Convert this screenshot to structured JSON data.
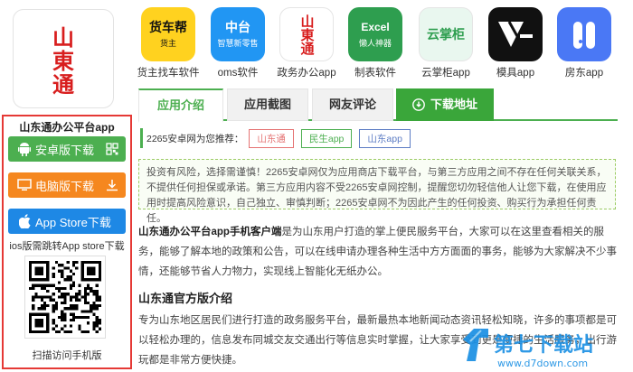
{
  "app": {
    "logo_text": "山東通",
    "panel_title": "山东通办公平台app"
  },
  "downloads": {
    "android_label": "安卓版下载",
    "pc_label": "电脑版下载",
    "ios_label": "App Store下载",
    "ios_note": "ios版需跳转App store下载",
    "qr_caption": "扫描访问手机版"
  },
  "related_apps": [
    {
      "name": "货主找车软件",
      "icon": "truck-app-icon",
      "icon_text": "货车帮",
      "sub": "货主",
      "bg": "#ffd21f",
      "fg": "#111"
    },
    {
      "name": "oms软件",
      "icon": "oms-app-icon",
      "icon_text": "中台",
      "sub": "智慧新零售",
      "bg": "#2196f3",
      "fg": "#fff"
    },
    {
      "name": "政务办公app",
      "icon": "gov-office-app-icon",
      "icon_text": "山東通",
      "sub": "",
      "bg": "#ffffff",
      "fg": "#d81e1e"
    },
    {
      "name": "制表软件",
      "icon": "excel-app-icon",
      "icon_text": "Excel",
      "sub": "懒人神器",
      "bg": "#2e9e4f",
      "fg": "#fff"
    },
    {
      "name": "云掌柜app",
      "icon": "cloud-manager-app-icon",
      "icon_text": "云掌柜",
      "sub": "",
      "bg": "#e9f7ef",
      "fg": "#2e9e4f"
    },
    {
      "name": "模具app",
      "icon": "mold-app-icon",
      "icon_text": "M",
      "sub": "",
      "bg": "#111111",
      "fg": "#fff"
    },
    {
      "name": "房东app",
      "icon": "landlord-app-icon",
      "icon_text": "",
      "sub": "",
      "bg": "#4a78f5",
      "fg": "#fff"
    }
  ],
  "tabs": {
    "intro": "应用介绍",
    "screenshots": "应用截图",
    "comments": "网友评论",
    "download": "下载地址"
  },
  "recommend": {
    "label": "2265安卓网为您推荐：",
    "tags": [
      {
        "text": "山东通",
        "color": "#e57373"
      },
      {
        "text": "民生app",
        "color": "#4caf50"
      },
      {
        "text": "山东app",
        "color": "#5c7cc4"
      }
    ]
  },
  "disclaimer": "投资有风险，选择需谨慎！2265安卓网仅为应用商店下载平台，与第三方应用之间不存在任何关联关系，不提供任何担保或承诺。第三方应用内容不受2265安卓网控制，提醒您切勿轻信他人让您下载，在使用应用时提高风险意识，自己独立、审慎判断；2265安卓网不为因此产生的任何投资、购买行为承担任何责任。",
  "intro": {
    "lead_bold": "山东通办公平台app手机客户端",
    "lead_rest": "是为山东用户打造的掌上便民服务平台，大家可以在这里查看相关的服务，能够了解本地的政策和公告，可以在线申请办理各种生活中方方面面的事务，能够为大家解决不少事情，还能够节省人力物力，实现线上智能化无纸办公。",
    "section_title": "山东通官方版介绍",
    "section_text": "专为山东地区居民们进行打造的政务服务平台，最新最热本地新闻动态资讯轻松知晓，许多的事项都是可以轻松办理的，信息发布同城交友交通出行等信息实时掌握，让大家享受到更是便捷的生活服务，出行游玩都是非常方便快捷。"
  },
  "watermark": {
    "brand": "第七下载站",
    "url": "www.d7down.com"
  },
  "colors": {
    "accent_green": "#4caf50",
    "panel_border": "#e53935",
    "btn_android": "#4caf50",
    "btn_pc": "#f5871f",
    "btn_ios": "#1e88e5"
  }
}
